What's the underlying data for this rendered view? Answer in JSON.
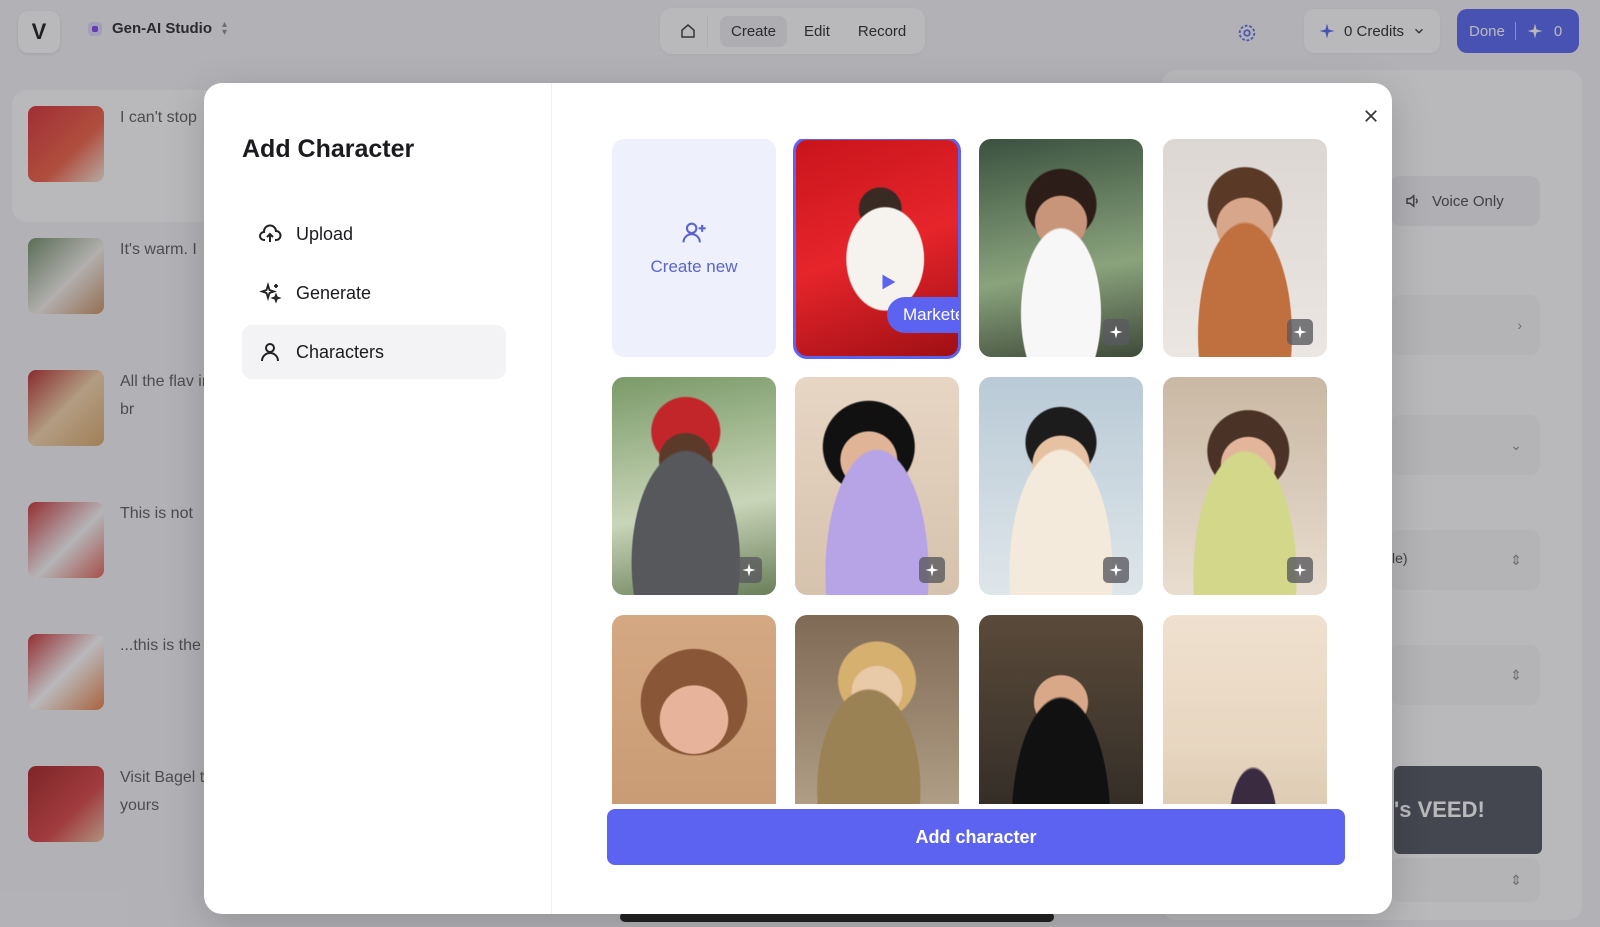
{
  "topbar": {
    "logo_letter": "V",
    "project_name": "Gen-AI Studio",
    "modes": [
      "Create",
      "Edit",
      "Record"
    ],
    "credits_label": "0 Credits",
    "done_label": "Done",
    "done_count": "0"
  },
  "script": {
    "rows": [
      {
        "text": "I can't stop"
      },
      {
        "text": "It's warm. I"
      },
      {
        "text": "All the flav into the br"
      },
      {
        "text": "This is not"
      },
      {
        "text": "...this is the"
      },
      {
        "text": "Visit Bagel treat yours"
      }
    ]
  },
  "right_panel": {
    "voice_only_label": "Voice Only",
    "partial_label": "le)",
    "banner_text": "'s VEED!"
  },
  "modal": {
    "title": "Add Character",
    "nav": [
      {
        "label": "Upload",
        "icon": "cloud-upload-icon"
      },
      {
        "label": "Generate",
        "icon": "sparkles-icon"
      },
      {
        "label": "Characters",
        "icon": "person-icon",
        "active": true
      }
    ],
    "create_new_label": "Create new",
    "selected_label": "Marketer",
    "add_button_label": "Add character"
  },
  "colors": {
    "accent": "#5b63f0",
    "done_button": "#4f5ff0",
    "create_tile": "#eef0fb"
  }
}
